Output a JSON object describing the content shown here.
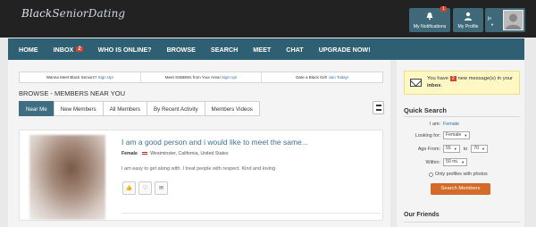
{
  "header": {
    "logo_part1": "Black",
    "logo_part2": "Senior",
    "logo_part3": "Dating",
    "notifications_label": "My Notifications",
    "notifications_count": "1",
    "profile_label": "My Profile",
    "user_initials": "jo"
  },
  "nav": {
    "items": [
      {
        "label": "HOME"
      },
      {
        "label": "INBOX",
        "badge": "2"
      },
      {
        "label": "WHO IS ONLINE?"
      },
      {
        "label": "BROWSE"
      },
      {
        "label": "SEARCH"
      },
      {
        "label": "MEET"
      },
      {
        "label": "CHAT"
      },
      {
        "label": "UPGRADE NOW!"
      }
    ]
  },
  "promo": {
    "p1_text": "Wanna Meet Black Seniors?",
    "p1_link": "Sign Up!",
    "p2_text": "Meet SSBBWs from Your Area!",
    "p2_link": "Sign Up!",
    "p3_text": "Date a Black Girl!",
    "p3_link": "Join Today!"
  },
  "browse": {
    "title": "BROWSE - MEMBERS NEAR YOU",
    "tabs": [
      "Near Me",
      "New Members",
      "All Members",
      "By Recent Activity",
      "Members Videos"
    ]
  },
  "member": {
    "headline": "I am a good person and i would like to meet the same...",
    "gender": "Female",
    "location": "Westminster, California, United States",
    "description": "I am easy to get along with. I treat people with respect. Kind and loving"
  },
  "messages": {
    "prefix": "You have",
    "count": "2",
    "suffix": "new message(s) in your",
    "inbox": "inbox",
    "end": "."
  },
  "quick_search": {
    "title": "Quick Search",
    "i_am_label": "I am:",
    "i_am_value": "Female",
    "looking_label": "Looking for:",
    "looking_value": "Female",
    "age_label": "Age From:",
    "age_from": "55",
    "age_to_label": "to",
    "age_to": "70",
    "within_label": "Within:",
    "within_value": "50 mi.",
    "photos_label": "Only profiles with photos",
    "button": "Search Members"
  },
  "friends": {
    "title": "Our Friends"
  }
}
